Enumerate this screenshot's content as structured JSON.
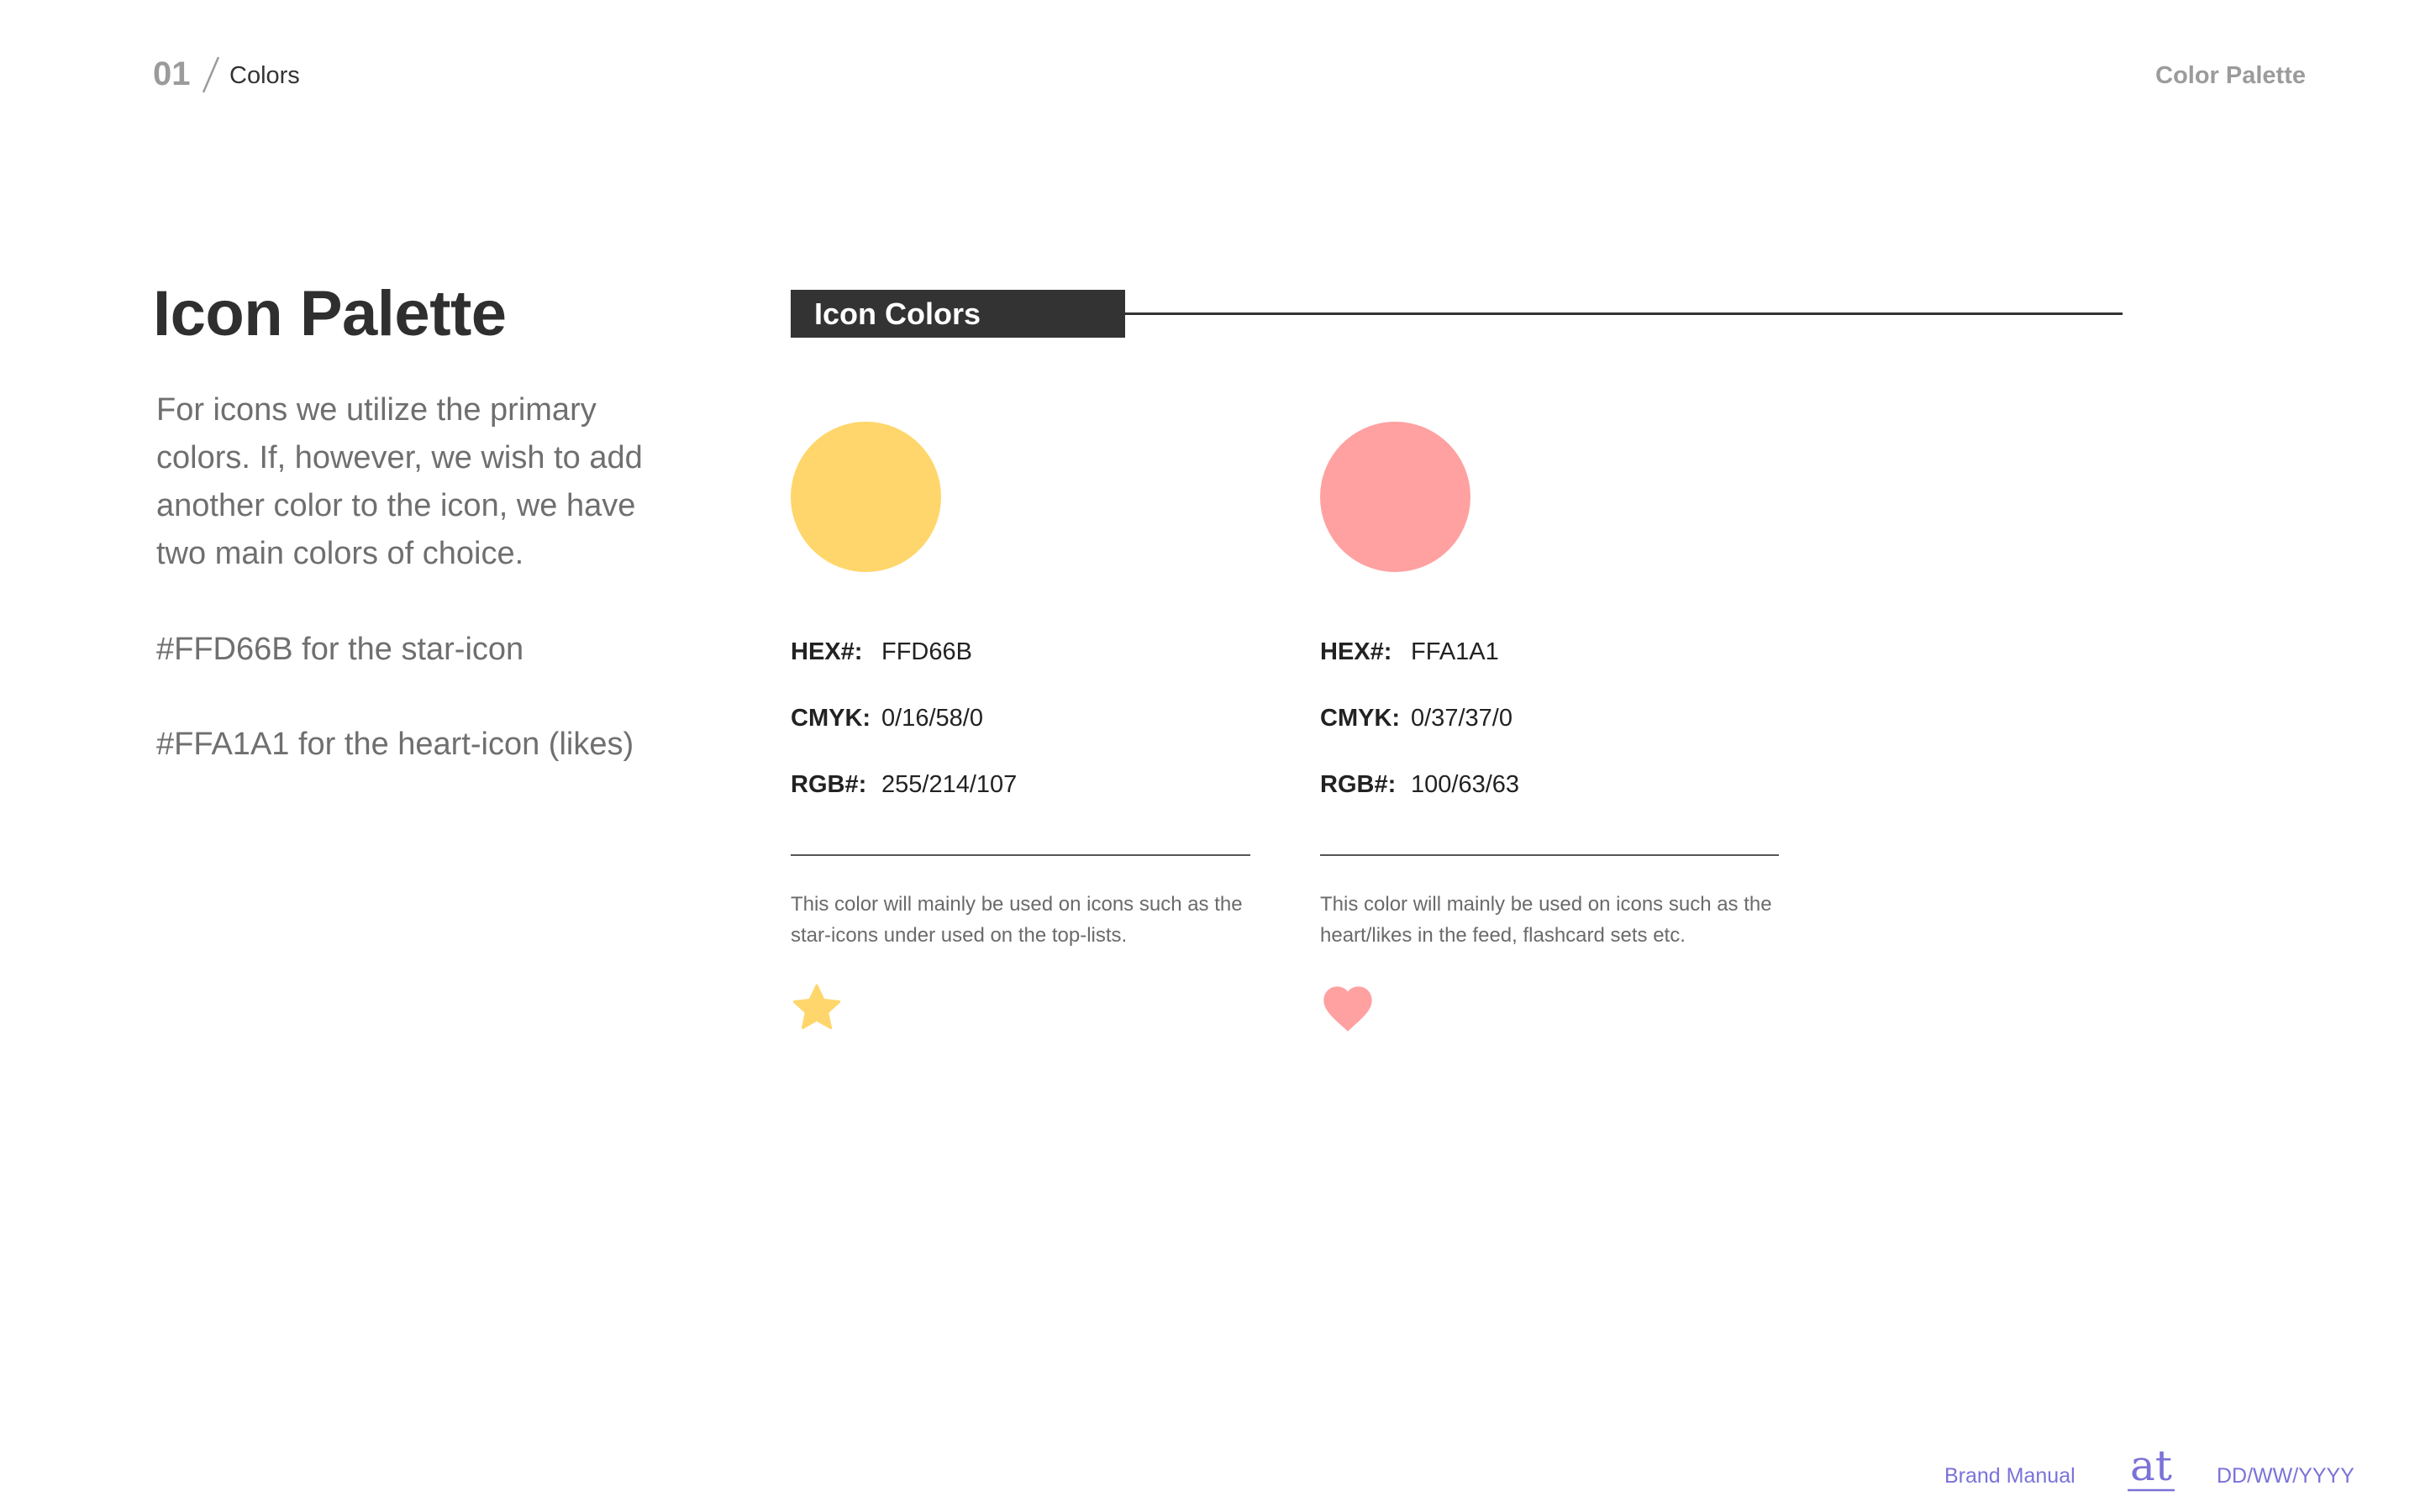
{
  "header": {
    "number": "01",
    "section": "Colors",
    "right_title": "Color Palette"
  },
  "left": {
    "title": "Icon Palette",
    "intro": "For icons we utilize the primary colors. If, however, we wish to add another color to the icon, we have two main colors of choice.",
    "note_star": "#FFD66B for the star-icon",
    "note_heart": "#FFA1A1 for the heart-icon (likes)"
  },
  "section": {
    "label": "Icon Colors"
  },
  "colors": [
    {
      "swatch_color": "#FFD66B",
      "hex_key": "HEX#:",
      "hex_value": "FFD66B",
      "cmyk_key": "CMYK:",
      "cmyk_value": "0/16/58/0",
      "rgb_key": "RGB#:",
      "rgb_value": "255/214/107",
      "description": "This color will mainly be used on icons such as the star-icons under used on the top-lists.",
      "icon": "star-icon"
    },
    {
      "swatch_color": "#FFA1A1",
      "hex_key": "HEX#:",
      "hex_value": "FFA1A1",
      "cmyk_key": "CMYK:",
      "cmyk_value": "0/37/37/0",
      "rgb_key": "RGB#:",
      "rgb_value": "100/63/63",
      "description": "This color will mainly be used on icons such as the heart/likes in the feed, flashcard sets etc.",
      "icon": "heart-icon"
    }
  ],
  "footer": {
    "left": "Brand Manual",
    "logo_text": "at",
    "right": "DD/WW/YYYY",
    "accent": "#7B72D8"
  }
}
